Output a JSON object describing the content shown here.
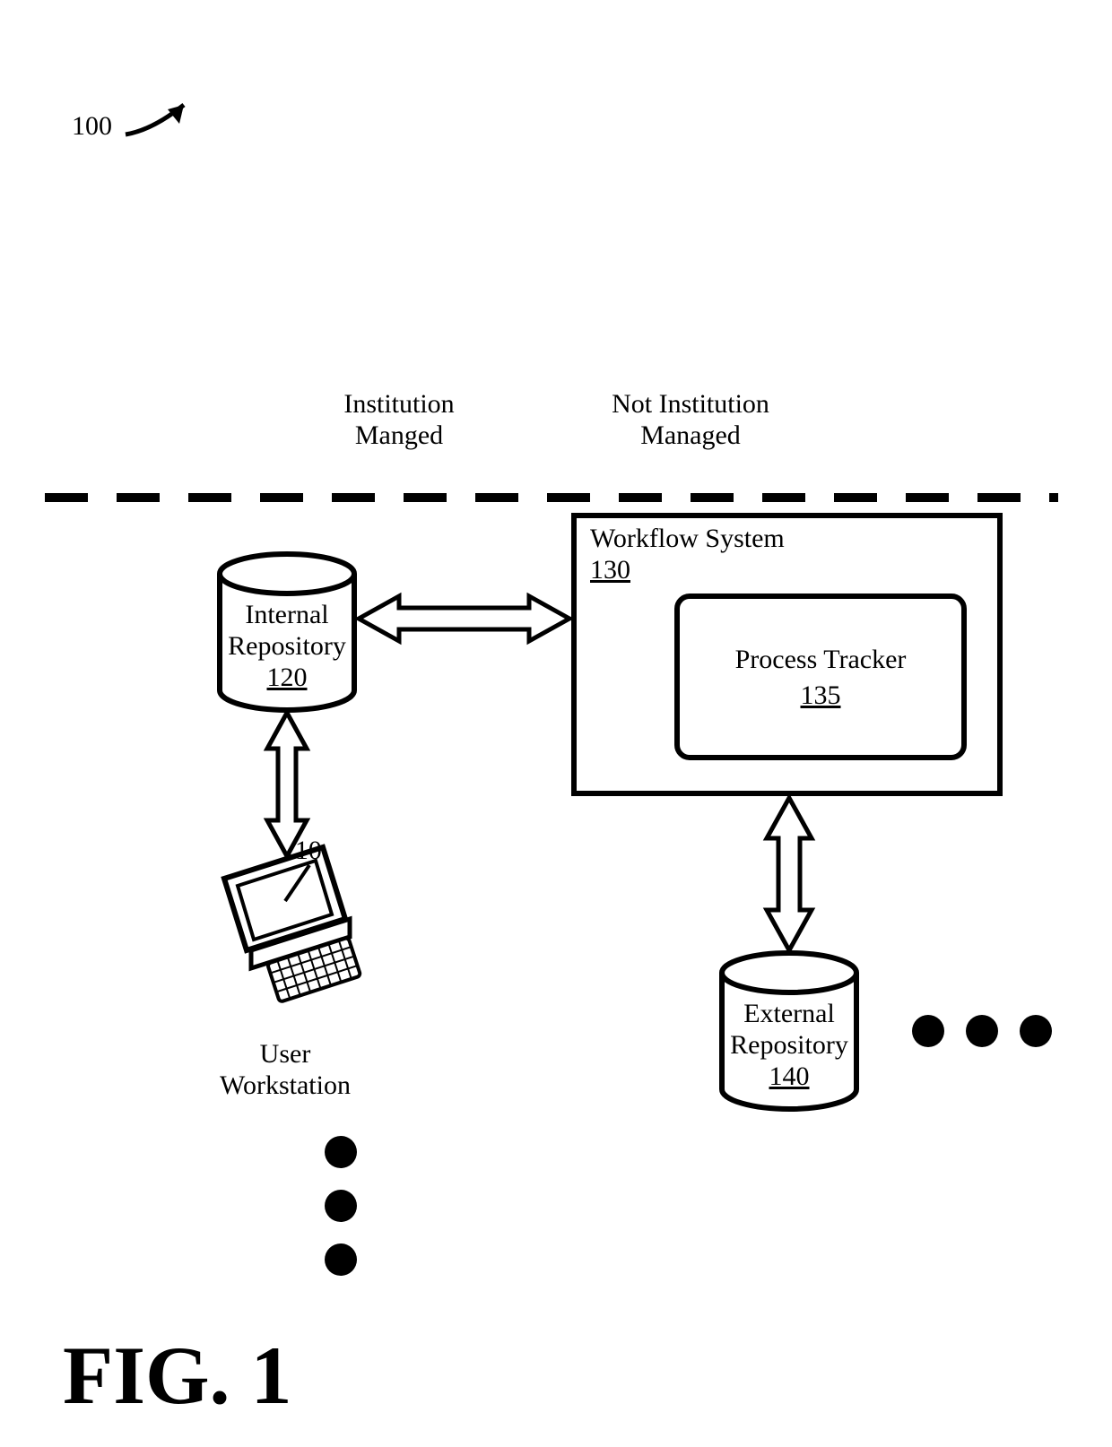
{
  "figure_label": "FIG. 1",
  "reference_numeral": "100",
  "left_region_line1": "Institution",
  "left_region_line2": "Manged",
  "right_region_line1": "Not Institution",
  "right_region_line2": "Managed",
  "workstation": {
    "callout": "110",
    "label_line1": "User",
    "label_line2": "Workstation"
  },
  "internal_repo": {
    "label_line1": "Internal",
    "label_line2": "Repository",
    "ref": "120"
  },
  "workflow": {
    "label": "Workflow System",
    "ref": "130"
  },
  "tracker": {
    "label": "Process Tracker",
    "ref": "135"
  },
  "external_repo": {
    "label_line1": "External",
    "label_line2": "Repository",
    "ref": "140"
  }
}
